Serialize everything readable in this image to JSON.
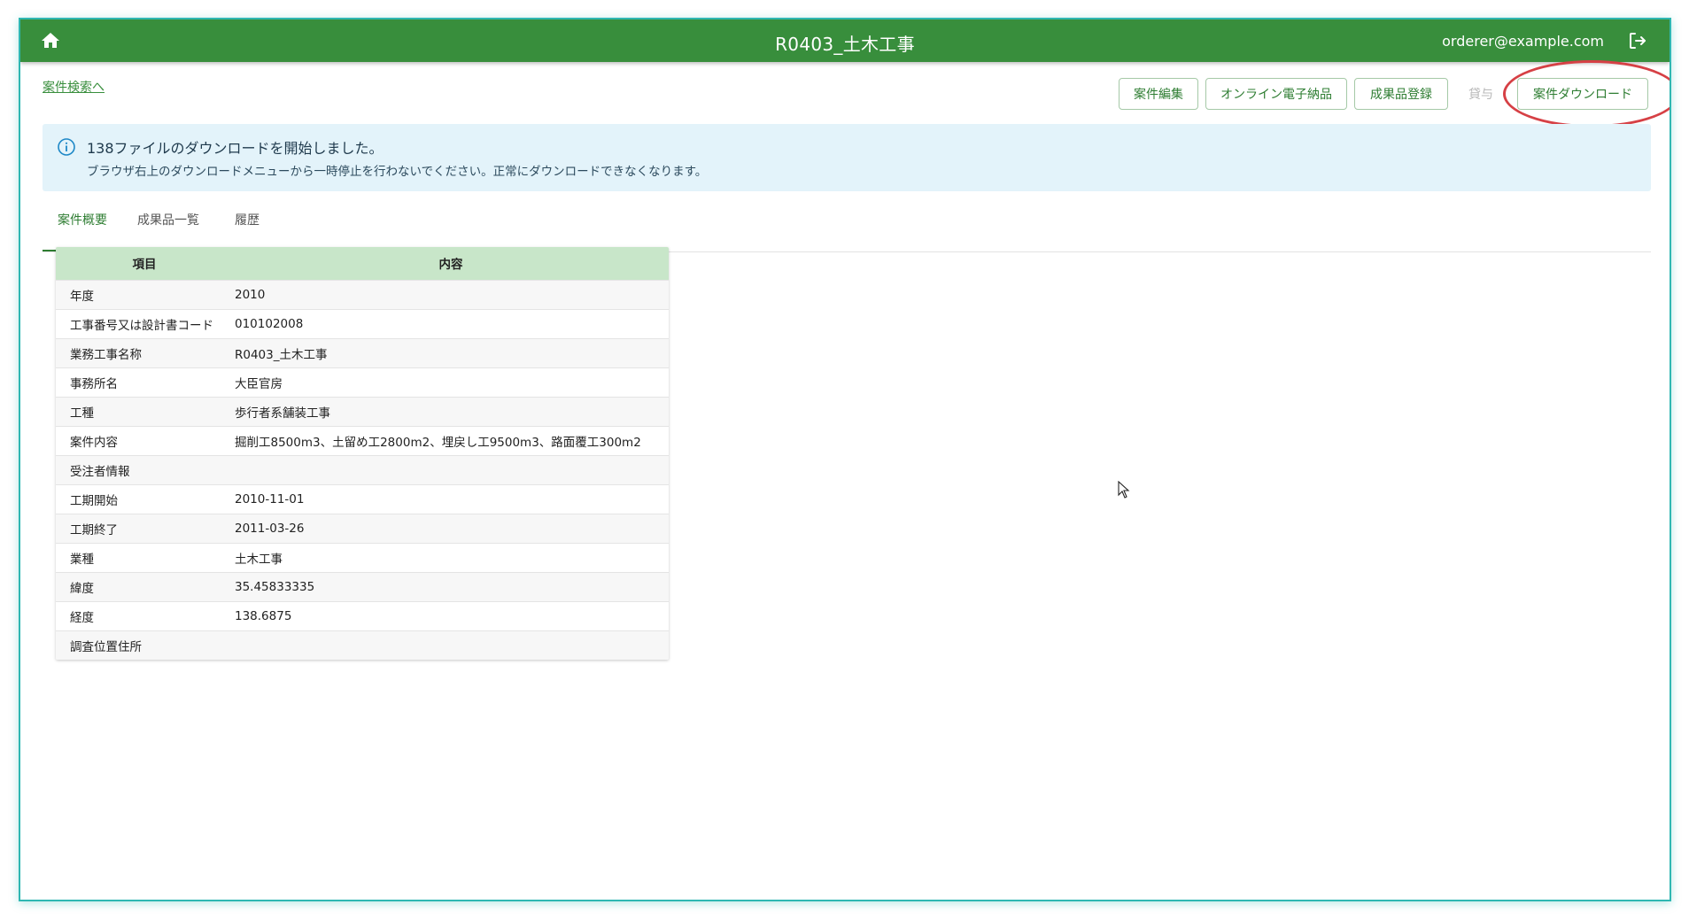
{
  "app_bar": {
    "title": "R0403_土木工事",
    "user_email": "orderer@example.com",
    "home_icon": "home-icon",
    "logout_icon": "logout-icon",
    "color": "#388e3c"
  },
  "back_link": "案件検索へ",
  "actions": {
    "edit": "案件編集",
    "online_delivery": "オンライン電子納品",
    "register_results": "成果品登録",
    "lend": "貸与",
    "download": "案件ダウンロード"
  },
  "alert": {
    "icon": "info-icon",
    "title": "138ファイルのダウンロードを開始しました。",
    "message": "ブラウザ右上のダウンロードメニューから一時停止を行わないでください。正常にダウンロードできなくなります。"
  },
  "tabs": [
    "案件概要",
    "成果品一覧",
    "履歴"
  ],
  "table": {
    "headers": [
      "項目",
      "内容"
    ],
    "rows": [
      [
        "年度",
        "2010"
      ],
      [
        "工事番号又は設計書コード",
        "010102008"
      ],
      [
        "業務工事名称",
        "R0403_土木工事"
      ],
      [
        "事務所名",
        "大臣官房"
      ],
      [
        "工種",
        "歩行者系舗装工事"
      ],
      [
        "案件内容",
        "掘削工8500m3、土留め工2800m2、埋戻し工9500m3、路面覆工300m2"
      ],
      [
        "受注者情報",
        ""
      ],
      [
        "工期開始",
        "2010-11-01"
      ],
      [
        "工期終了",
        "2011-03-26"
      ],
      [
        "業種",
        "土木工事"
      ],
      [
        "緯度",
        "35.45833335"
      ],
      [
        "経度",
        "138.6875"
      ],
      [
        "調査位置住所",
        ""
      ]
    ]
  }
}
